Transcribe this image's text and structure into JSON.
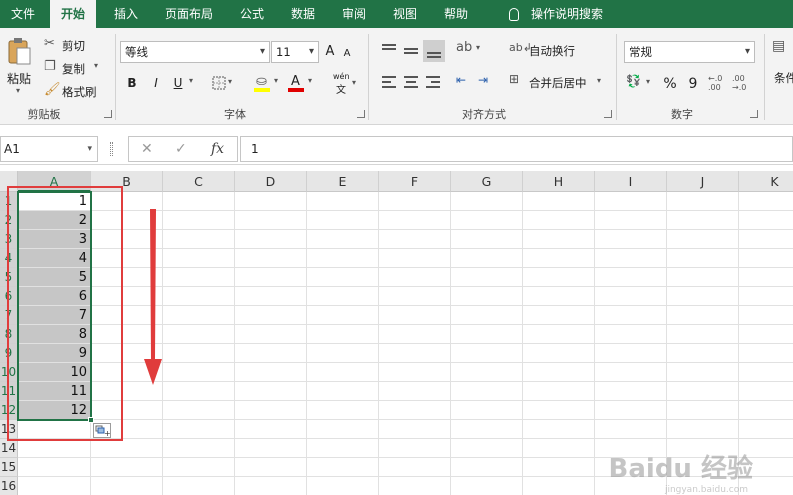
{
  "tabs": [
    {
      "label": "文件",
      "active": false
    },
    {
      "label": "开始",
      "active": true
    },
    {
      "label": "插入",
      "active": false
    },
    {
      "label": "页面布局",
      "active": false
    },
    {
      "label": "公式",
      "active": false
    },
    {
      "label": "数据",
      "active": false
    },
    {
      "label": "审阅",
      "active": false
    },
    {
      "label": "视图",
      "active": false
    },
    {
      "label": "帮助",
      "active": false
    }
  ],
  "search_label": "操作说明搜索",
  "clipboard": {
    "paste": "粘贴",
    "cut": "剪切",
    "copy": "复制",
    "format_painter": "格式刷",
    "group": "剪贴板"
  },
  "font": {
    "name": "等线",
    "size": "11",
    "bold": "B",
    "italic": "I",
    "underline": "U",
    "phonetic_top": "wén",
    "phonetic_bottom": "文",
    "grow": "A",
    "shrink": "A",
    "group": "字体"
  },
  "alignment": {
    "wrap": "自动换行",
    "merge": "合并后居中",
    "group": "对齐方式"
  },
  "number": {
    "format": "常规",
    "percent": "%",
    "comma": "9",
    "group": "数字"
  },
  "styles_label": "条件",
  "formula_bar": {
    "name_box": "A1",
    "fx": "fx",
    "value": "1"
  },
  "columns": [
    "A",
    "B",
    "C",
    "D",
    "E",
    "F",
    "G",
    "H",
    "I",
    "J",
    "K"
  ],
  "rows": [
    "1",
    "2",
    "3",
    "4",
    "5",
    "6",
    "7",
    "8",
    "9",
    "10",
    "11",
    "12",
    "13",
    "14",
    "15",
    "16"
  ],
  "cells_A": [
    "1",
    "2",
    "3",
    "4",
    "5",
    "6",
    "7",
    "8",
    "9",
    "10",
    "11",
    "12"
  ],
  "watermark": {
    "main": "Baidu 经验",
    "sub": "jingyan.baidu.com"
  },
  "colors": {
    "ribbon_green": "#217346",
    "annotation_red": "#e03c3c",
    "selection_gray": "#c6c6c6"
  }
}
